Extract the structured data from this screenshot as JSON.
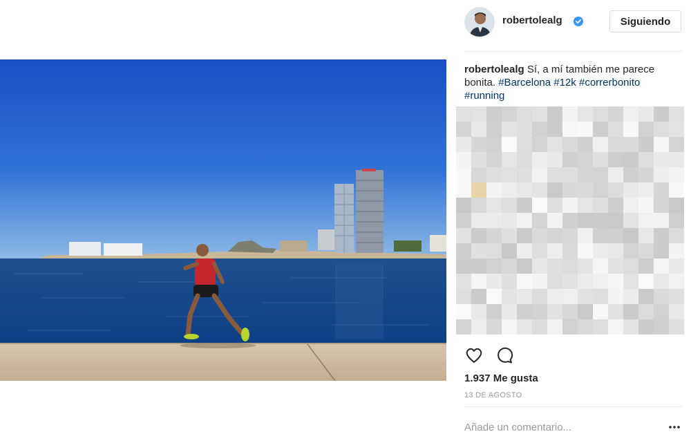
{
  "post": {
    "image_alt": "Corredor junto al mar en Barcelona",
    "username": "robertolealg",
    "verified_icon": "verified-badge-icon",
    "follow_label": "Siguiendo",
    "caption": {
      "author": "robertolealg",
      "text": "Sí, a mí también me parece bonita.",
      "hashtags": [
        "#Barcelona",
        "#12k",
        "#correrbonito",
        "#running"
      ]
    },
    "likes": "1.937 Me gusta",
    "date": "13 DE AGOSTO",
    "comment_placeholder": "Añade un comentario...",
    "icons": {
      "like": "heart-icon",
      "comment": "comment-bubble-icon",
      "more": "more-options-icon"
    },
    "colors": {
      "link": "#003569",
      "verified": "#3897f0",
      "muted": "#999999"
    }
  }
}
